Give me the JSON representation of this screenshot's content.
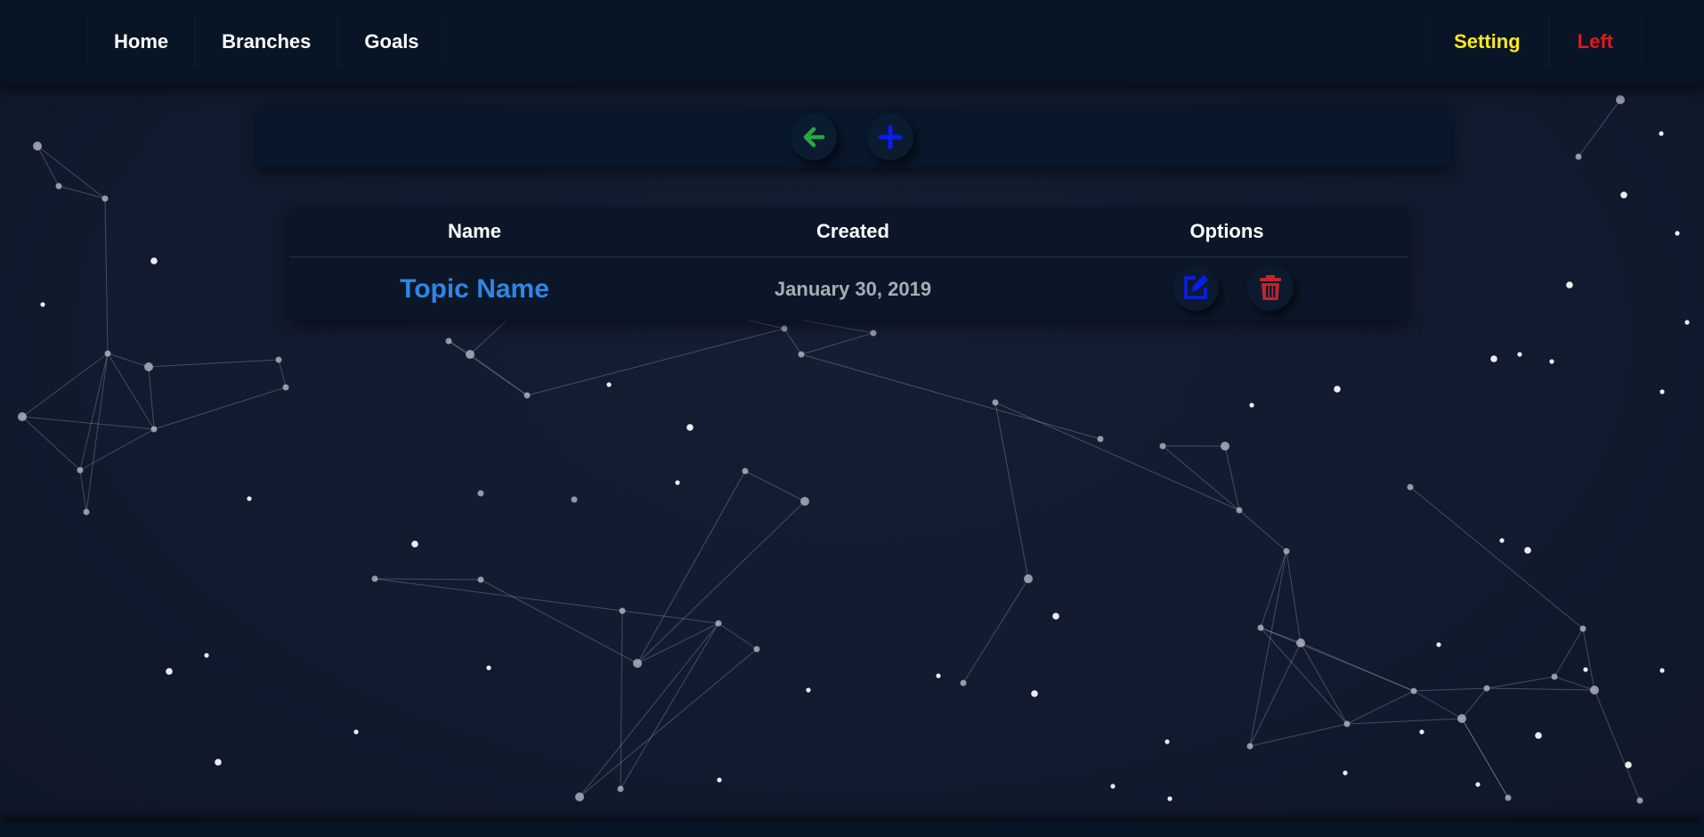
{
  "nav": {
    "left_items": [
      {
        "label": "Home",
        "name": "nav-home"
      },
      {
        "label": "Branches",
        "name": "nav-branches"
      },
      {
        "label": "Goals",
        "name": "nav-goals"
      }
    ],
    "setting_label": "Setting",
    "left_label": "Left",
    "colors": {
      "setting": "#ffe81a",
      "left": "#e0191c"
    }
  },
  "toolbar": {
    "back_icon": "arrow-left-icon",
    "add_icon": "plus-icon",
    "colors": {
      "back": "#28a745",
      "add": "#0a1cf0"
    }
  },
  "table": {
    "headers": {
      "name": "Name",
      "created": "Created",
      "options": "Options"
    },
    "rows": [
      {
        "name": "Topic Name",
        "created": "January 30, 2019"
      }
    ],
    "option_icons": {
      "edit": "edit-icon",
      "delete": "trash-icon"
    },
    "colors": {
      "name_link": "#2e86e6",
      "edit": "#0a1cf0",
      "delete": "#c0262d"
    }
  }
}
